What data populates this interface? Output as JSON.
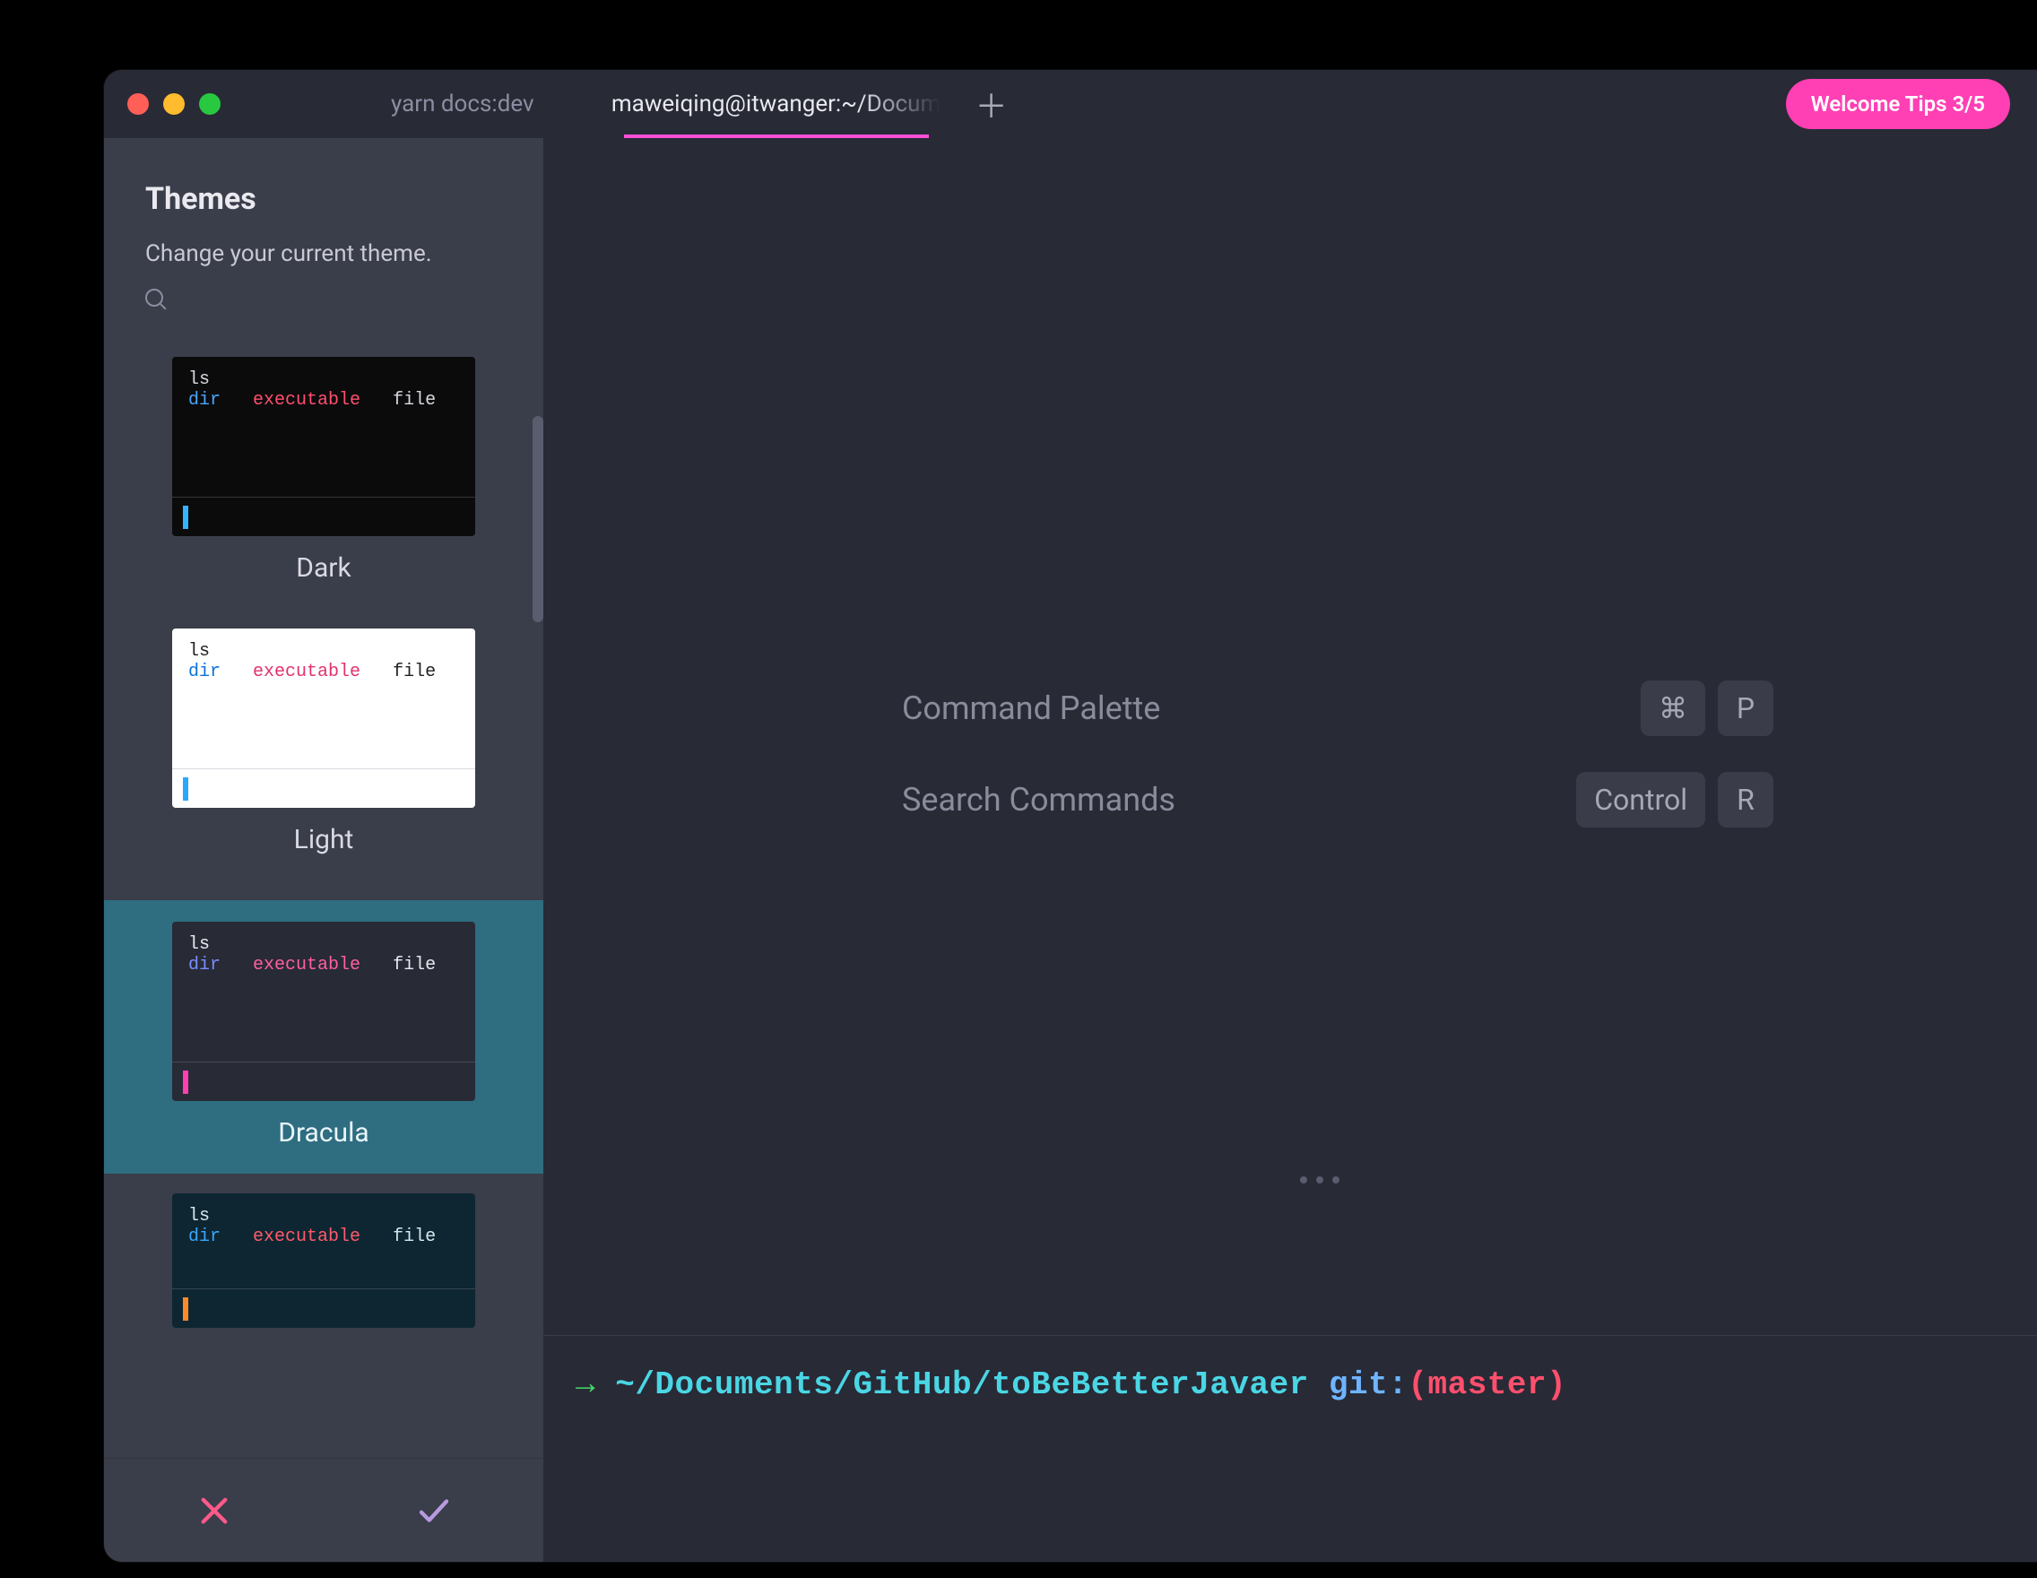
{
  "window": {
    "tabs": [
      {
        "label": "yarn docs:dev",
        "active": false
      },
      {
        "label": "maweiqing@itwanger:~/Docum",
        "active": true
      }
    ],
    "tips_label": "Welcome Tips 3/5"
  },
  "sidebar": {
    "title": "Themes",
    "subtitle": "Change your current theme.",
    "preview": {
      "ls": "ls",
      "dir": "dir",
      "exe": "executable",
      "file": "file"
    },
    "themes": [
      {
        "name": "Dark",
        "variant": "pv-dark",
        "selected": false
      },
      {
        "name": "Light",
        "variant": "pv-light",
        "selected": false
      },
      {
        "name": "Dracula",
        "variant": "pv-dracula",
        "selected": true
      },
      {
        "name": "",
        "variant": "pv-teal",
        "selected": false
      }
    ]
  },
  "main": {
    "hints": [
      {
        "label": "Command Palette",
        "keys": [
          "⌘",
          "P"
        ]
      },
      {
        "label": "Search Commands",
        "keys": [
          "Control",
          "R"
        ]
      }
    ],
    "prompt": {
      "arrow": "→ ",
      "path": "~/Documents/GitHub/toBeBetterJavaer",
      "git_word": "git:",
      "open_paren": "(",
      "branch": "master",
      "close_paren": ")"
    }
  }
}
